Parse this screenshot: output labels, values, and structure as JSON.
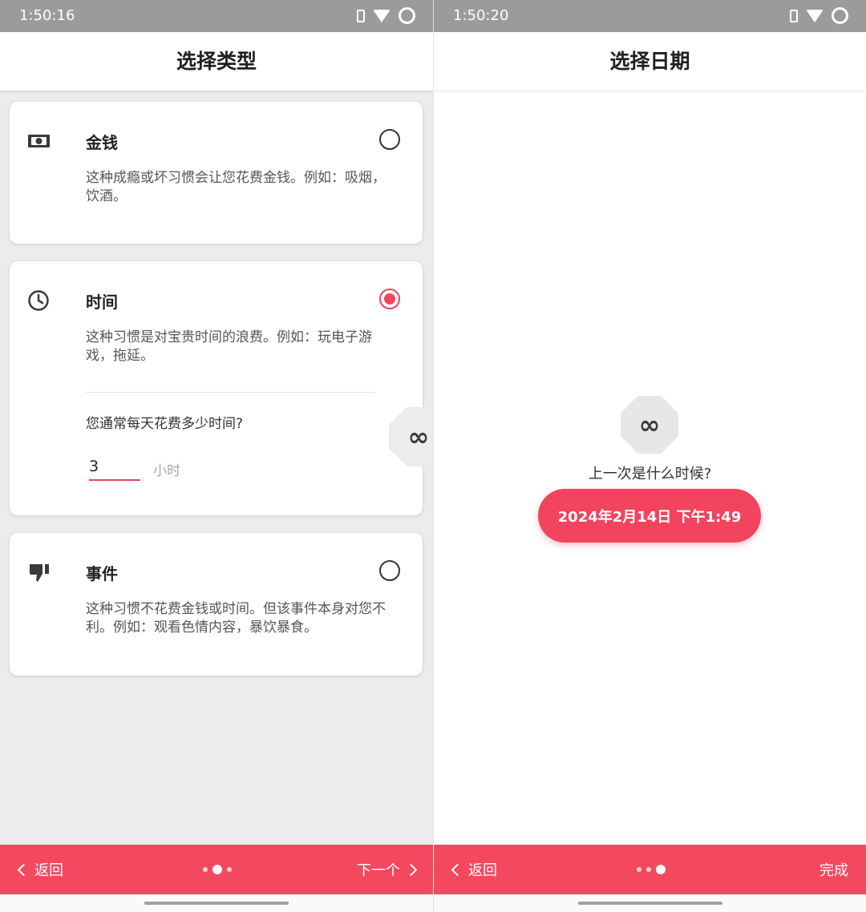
{
  "left": {
    "status": {
      "time": "1:50:16"
    },
    "title": "选择类型",
    "options": [
      {
        "title": "金钱",
        "icon": "money-icon",
        "description": "这种成瘾或坏习惯会让您花费金钱。例如：吸烟，饮酒。",
        "selected": false
      },
      {
        "title": "时间",
        "icon": "clock-icon",
        "description": "这种习惯是对宝贵时间的浪费。例如：玩电子游戏，拖延。",
        "selected": true
      },
      {
        "title": "事件",
        "icon": "thumbs-down-icon",
        "description": "这种习惯不花费金钱或时间。但该事件本身对您不利。例如：观看色情内容，暴饮暴食。",
        "selected": false
      }
    ],
    "time_question": "您通常每天花费多少时间?",
    "hours_value": "3",
    "hours_unit": "小时",
    "nav": {
      "back": "返回",
      "next": "下一个",
      "page": 2,
      "pages": 3
    }
  },
  "right": {
    "status": {
      "time": "1:50:20"
    },
    "title": "选择日期",
    "prompt": "上一次是什么时候?",
    "date_button": "2024年2月14日 下午1:49",
    "nav": {
      "back": "返回",
      "done": "完成",
      "page": 3,
      "pages": 3
    }
  },
  "logo_symbol": "∞",
  "colors": {
    "accent": "#f2435f",
    "status_bar": "#9b9b9b"
  }
}
